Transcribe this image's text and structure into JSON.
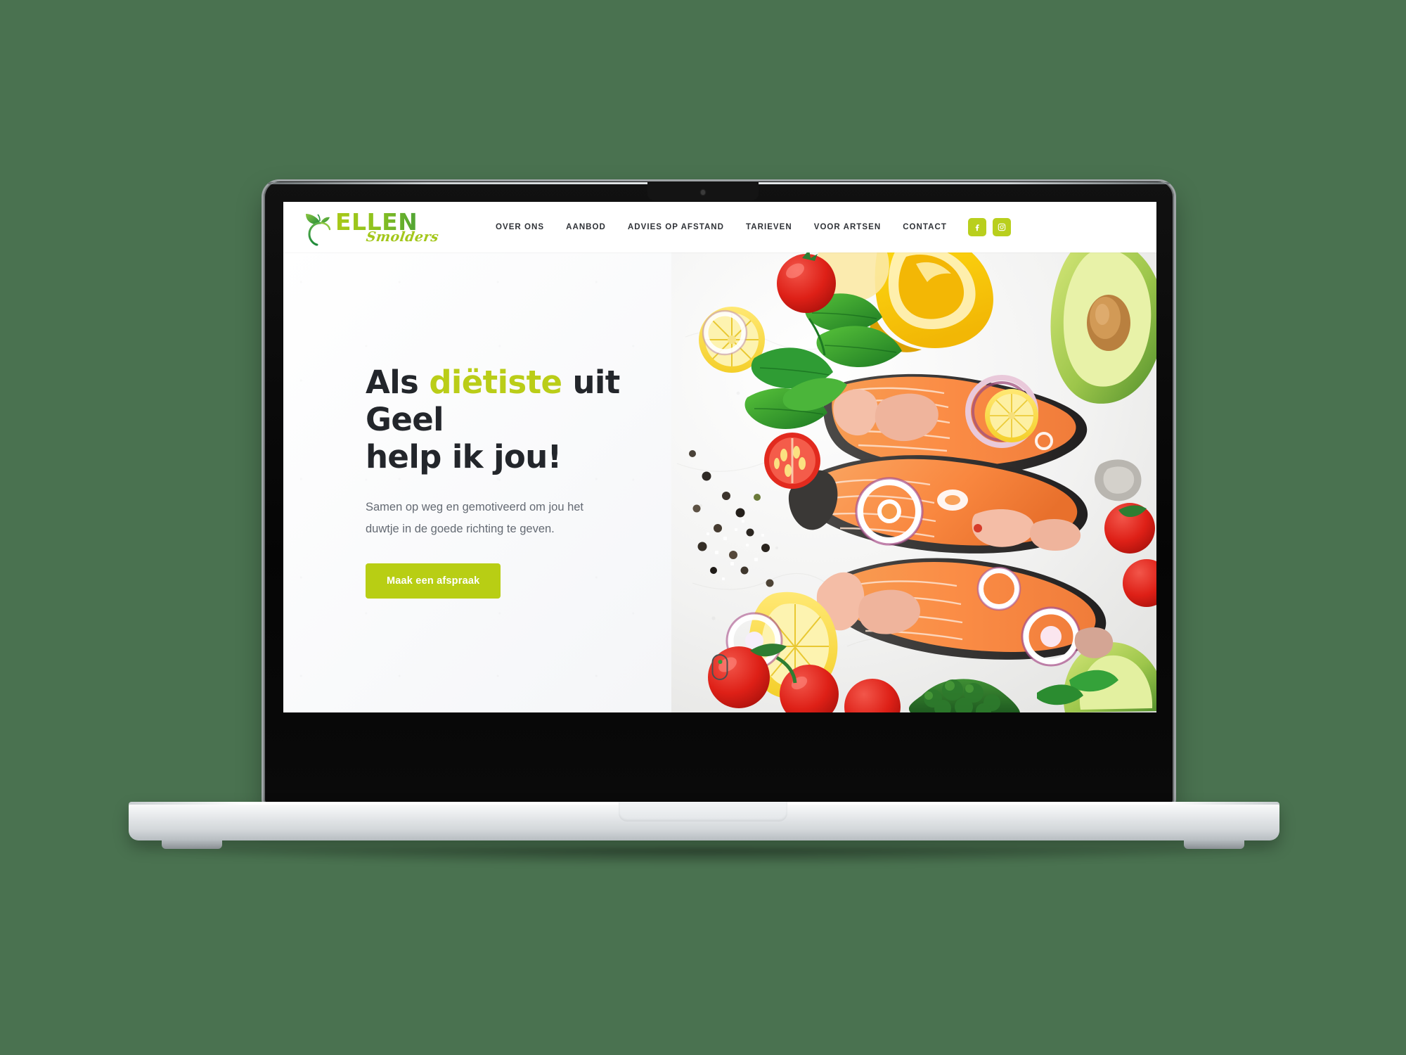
{
  "device": {
    "type": "laptop-mockup",
    "background_color": "#4a7250"
  },
  "site": {
    "logo": {
      "name": "ELLEN",
      "script": "Smolders",
      "icon": "apple-leaf-icon",
      "name_gradient_from": "#a9c918",
      "name_gradient_to": "#2f9440",
      "script_color": "#a4c71c"
    },
    "nav": {
      "items": [
        {
          "label": "OVER ONS"
        },
        {
          "label": "AANBOD"
        },
        {
          "label": "ADVIES OP AFSTAND"
        },
        {
          "label": "TARIEVEN"
        },
        {
          "label": "VOOR ARTSEN"
        },
        {
          "label": "CONTACT"
        }
      ]
    },
    "social": {
      "accent_color": "#b9cf1d",
      "items": [
        {
          "name": "facebook-icon",
          "label": "Facebook"
        },
        {
          "name": "instagram-icon",
          "label": "Instagram"
        }
      ]
    },
    "hero": {
      "title_part1": "Als ",
      "title_accent": "diëtiste",
      "title_part2": " uit Geel",
      "title_line2": "help ik jou!",
      "title_color": "#23262b",
      "accent_color": "#bacd18",
      "subtitle": "Samen op weg en gemotiveerd om jou het duwtje in de goede richting te geven.",
      "cta_label": "Maak een afspraak",
      "cta_color": "#b8ce14",
      "scroll_indicator_dot_color": "#2e9c3d",
      "photo_alt": "Zalmmoten met citroen, tomaten, basilicum, paprika, avocado en broccoli"
    }
  }
}
